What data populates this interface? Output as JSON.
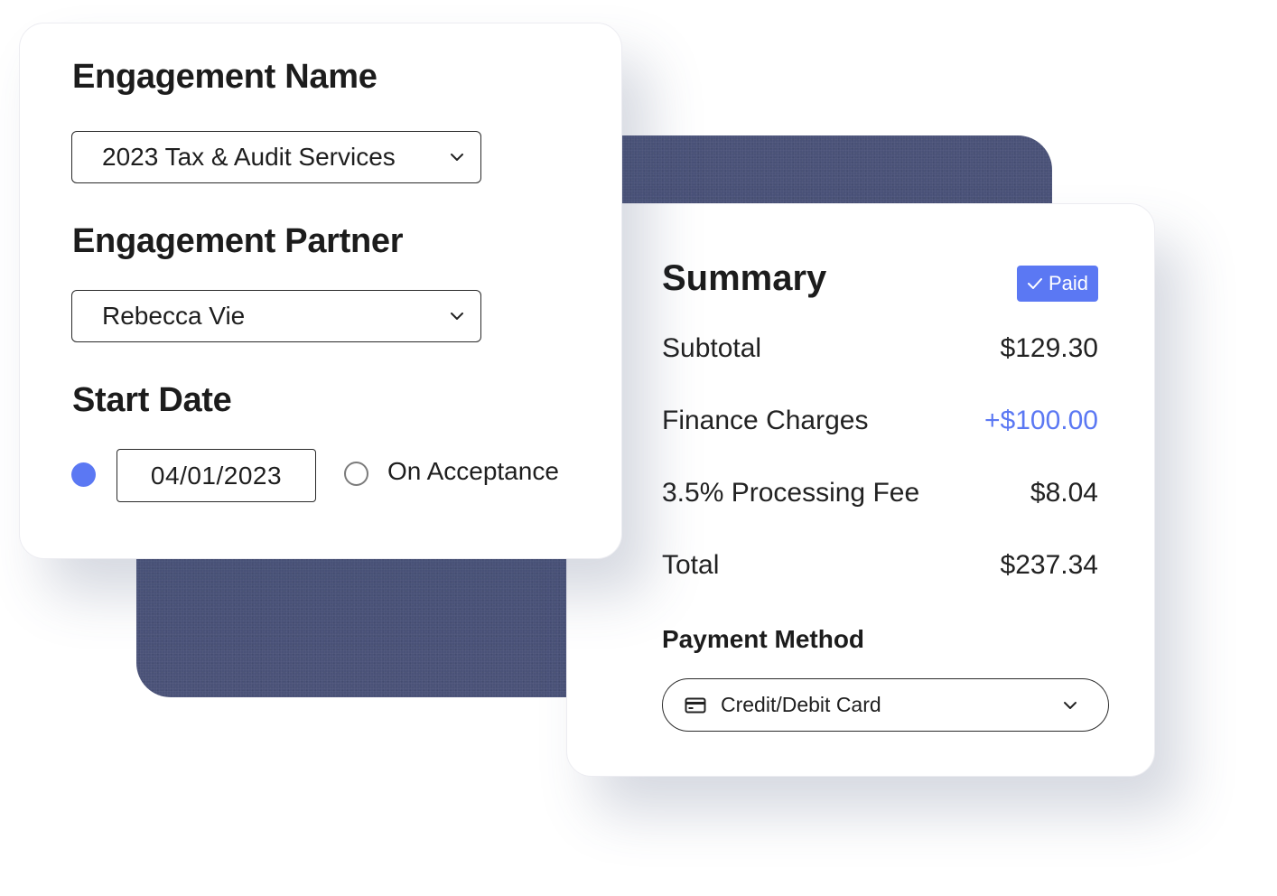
{
  "engagement": {
    "name_heading": "Engagement Name",
    "name_value": "2023 Tax & Audit Services",
    "partner_heading": "Engagement Partner",
    "partner_value": "Rebecca Vie",
    "start_heading": "Start Date",
    "start_date_value": "04/01/2023",
    "start_date_selected": true,
    "on_acceptance_label": "On Acceptance",
    "on_acceptance_selected": false
  },
  "summary": {
    "title": "Summary",
    "status_badge": "Paid",
    "lines": [
      {
        "label": "Subtotal",
        "amount": "$129.30"
      },
      {
        "label": "Finance Charges",
        "amount": "+$100.00"
      },
      {
        "label": "3.5% Processing Fee",
        "amount": "$8.04"
      },
      {
        "label": "Total",
        "amount": "$237.34"
      }
    ],
    "payment_method_heading": "Payment Method",
    "payment_method_value": "Credit/Debit Card"
  },
  "icons": {
    "dropdown": "chevron-down-icon",
    "badge": "check-icon",
    "payment": "credit-card-icon"
  },
  "colors": {
    "accent": "#5b78f3",
    "backdrop": "#4a5278"
  }
}
